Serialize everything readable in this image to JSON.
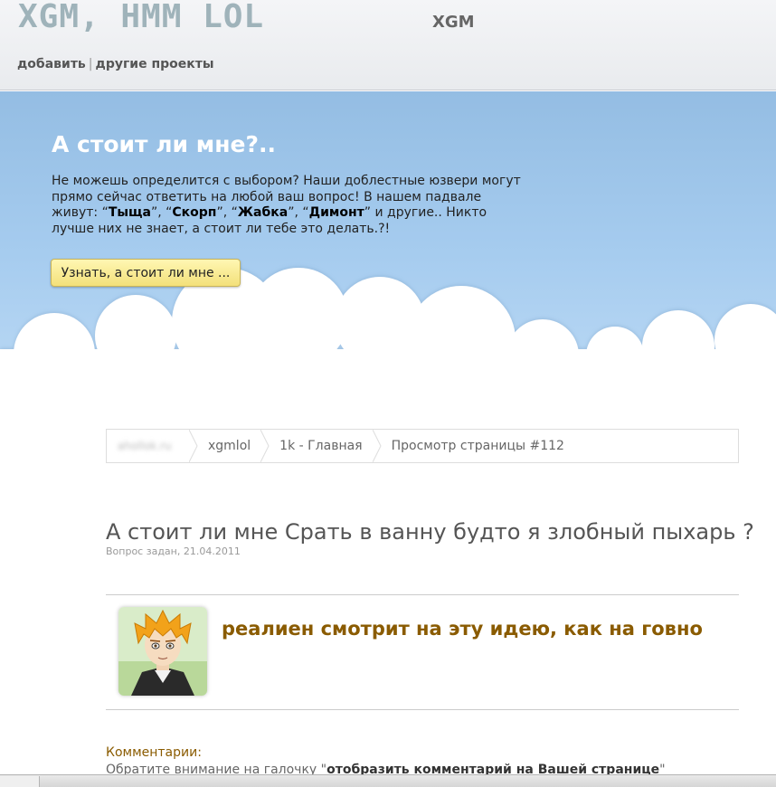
{
  "header": {
    "logo": "XGM, HMM LOL",
    "site_name": "XGM",
    "nav": [
      {
        "label": "добавить"
      },
      {
        "label": "другие проекты"
      }
    ],
    "nav_separator": "|"
  },
  "hero": {
    "title": "А стоит ли мне?..",
    "text_part1": "Не можешь определится с выбором? Наши доблестные юзвери могут прямо сейчас ответить на любой ваш вопрос! В нашем падвале живут: ",
    "users": [
      "Тыща",
      "Скорп",
      "Жабка",
      "Димонт"
    ],
    "text_part2": " и другие.. Никто лучше них не знает, а стоит ли тебе это делать.?!",
    "button_label": "Узнать, а стоит ли мне ..."
  },
  "breadcrumb": {
    "items": [
      "ahollok.ru",
      "xgmlol",
      "1k - Главная",
      "Просмотр страницы #112"
    ]
  },
  "question": {
    "title": "А стоит ли мне Срать в ванну будто я злобный пыхарь ?",
    "meta": "Вопрос задан, 21.04.2011"
  },
  "answer": {
    "text": "реалиен смотрит на эту идею, как на говно"
  },
  "comments": {
    "heading": "Комментарии:",
    "note_prefix": "Обратите внимание на галочку \"",
    "note_bold": "отобразить комментарий на Вашей странице",
    "note_suffix": "\""
  },
  "colors": {
    "sky": "#a6ccef",
    "answer": "#8a5b00",
    "button": "#f3e07a"
  }
}
